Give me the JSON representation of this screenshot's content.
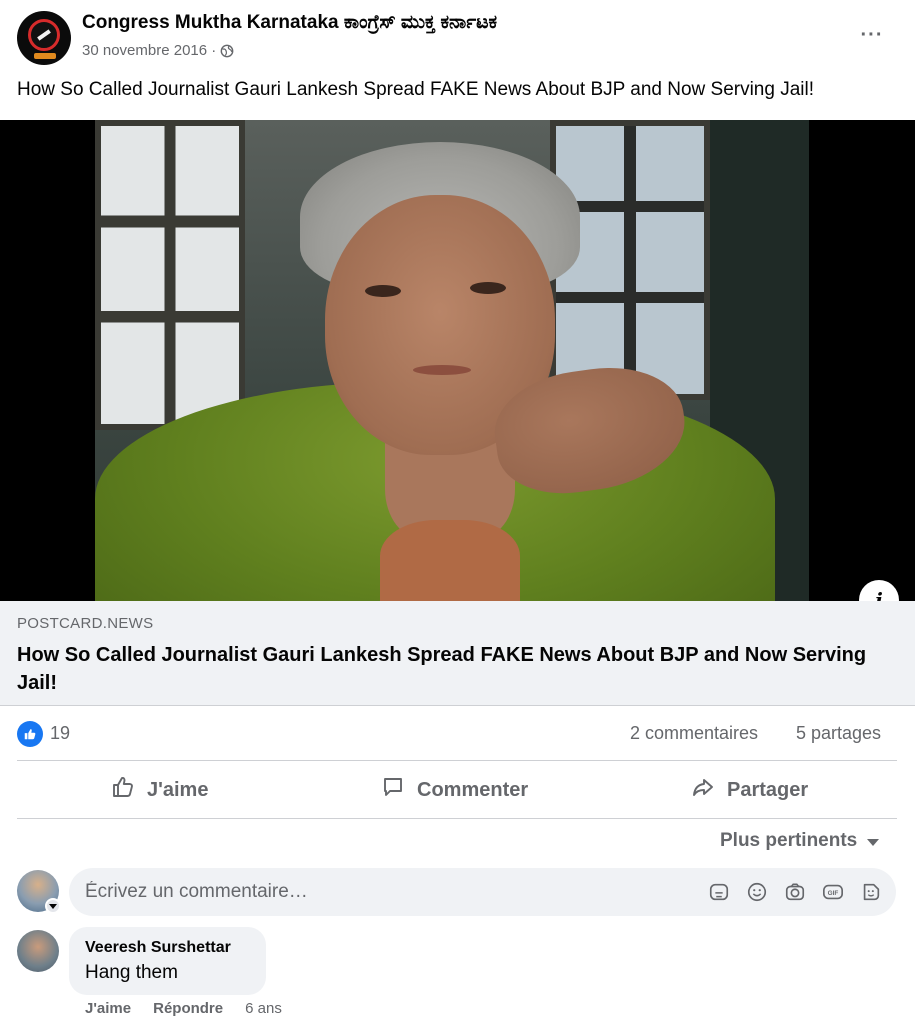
{
  "post": {
    "page_name": "Congress Muktha Karnataka ಕಾಂಗ್ರೆಸ್ ಮುಕ್ತ ಕರ್ನಾಟಕ",
    "date": "30 novembre 2016 ·",
    "more_label": "···",
    "text": "How So Called Journalist Gauri Lankesh Spread FAKE News About BJP and Now Serving Jail!"
  },
  "link": {
    "domain": "POSTCARD.NEWS",
    "title": "How So Called Journalist Gauri Lankesh Spread FAKE News About BJP and Now Serving Jail!",
    "info_label": "i"
  },
  "stats": {
    "reactions": "19",
    "comments": "2 commentaires",
    "shares": "5 partages"
  },
  "actions": {
    "like": "J'aime",
    "comment": "Commenter",
    "share": "Partager"
  },
  "sort": {
    "label": "Plus pertinents"
  },
  "composer": {
    "placeholder": "Écrivez un commentaire…",
    "icons": [
      "sticker-icon",
      "emoji-icon",
      "camera-icon",
      "gif-icon",
      "avatar-sticker-icon"
    ]
  },
  "comments": [
    {
      "author": "Veeresh Surshettar",
      "text": "Hang them",
      "like": "J'aime",
      "reply": "Répondre",
      "age": "6 ans"
    }
  ],
  "colors": {
    "accent": "#1877f2",
    "secondary_text": "#65676b",
    "surface": "#f0f2f5"
  }
}
